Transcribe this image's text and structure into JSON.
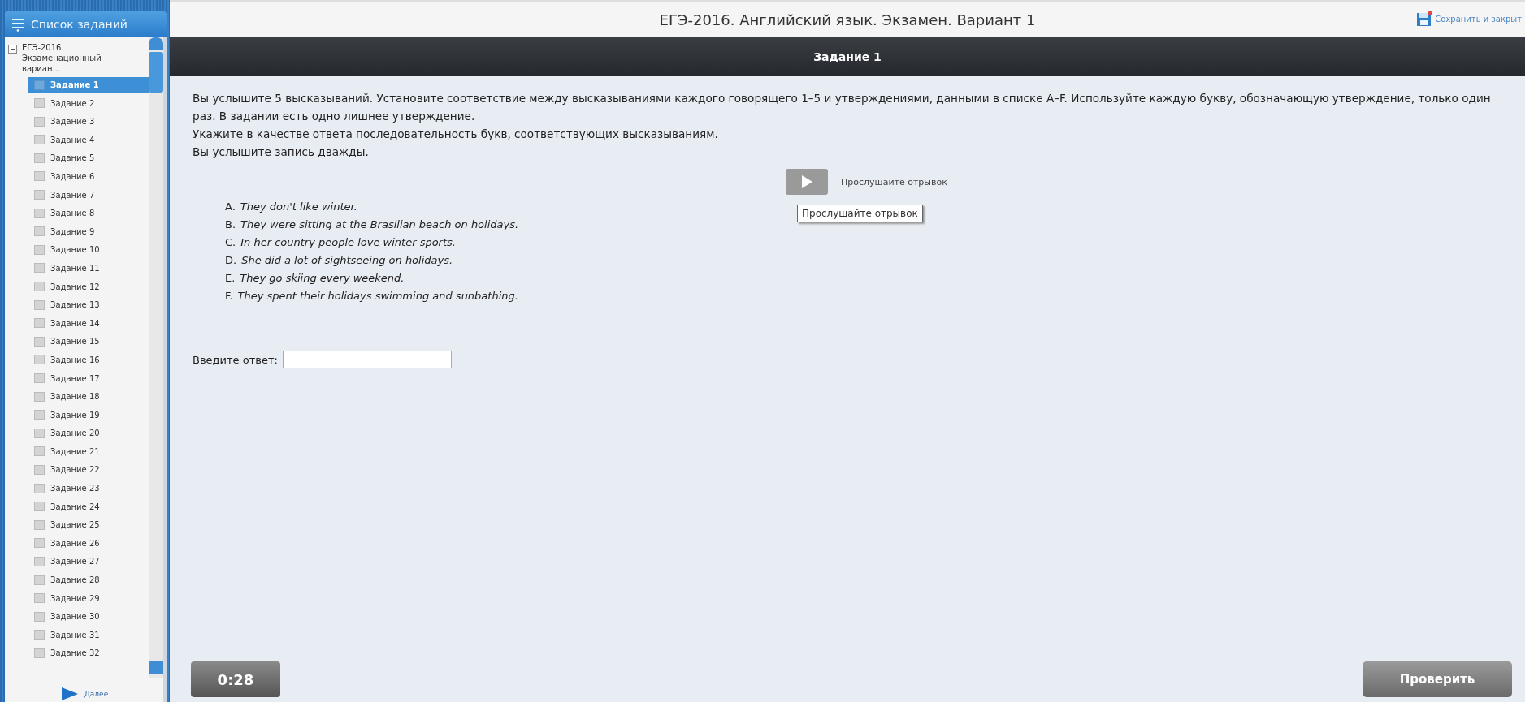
{
  "header": {
    "title": "ЕГЭ-2016. Английский язык. Экзамен. Вариант 1",
    "save_label": "Сохранить и закрыт"
  },
  "sidebar": {
    "title": "Список заданий",
    "tree": [
      {
        "label": "ЕГЭ-2016. Экзаменационный вариан...",
        "expanded": true,
        "children": [
          {
            "label": "Задание 1",
            "selected": true
          },
          {
            "label": "Задание 2",
            "selected": false
          },
          {
            "label": "Задание 3",
            "selected": false
          },
          {
            "label": "Задание 4",
            "selected": false
          },
          {
            "label": "Задание 5",
            "selected": false
          },
          {
            "label": "Задание 6",
            "selected": false
          },
          {
            "label": "Задание 7",
            "selected": false
          },
          {
            "label": "Задание 8",
            "selected": false
          },
          {
            "label": "Задание 9",
            "selected": false
          },
          {
            "label": "Задание 10",
            "selected": false
          },
          {
            "label": "Задание 11",
            "selected": false
          },
          {
            "label": "Задание 12",
            "selected": false
          },
          {
            "label": "Задание 13",
            "selected": false
          },
          {
            "label": "Задание 14",
            "selected": false
          },
          {
            "label": "Задание 15",
            "selected": false
          },
          {
            "label": "Задание 16",
            "selected": false
          },
          {
            "label": "Задание 17",
            "selected": false
          },
          {
            "label": "Задание 18",
            "selected": false
          },
          {
            "label": "Задание 19",
            "selected": false
          },
          {
            "label": "Задание 20",
            "selected": false
          },
          {
            "label": "Задание 21",
            "selected": false
          },
          {
            "label": "Задание 22",
            "selected": false
          },
          {
            "label": "Задание 23",
            "selected": false
          },
          {
            "label": "Задание 24",
            "selected": false
          },
          {
            "label": "Задание 25",
            "selected": false
          },
          {
            "label": "Задание 26",
            "selected": false
          },
          {
            "label": "Задание 27",
            "selected": false
          },
          {
            "label": "Задание 28",
            "selected": false
          },
          {
            "label": "Задание 29",
            "selected": false
          },
          {
            "label": "Задание 30",
            "selected": false
          },
          {
            "label": "Задание 31",
            "selected": false
          },
          {
            "label": "Задание 32",
            "selected": false
          }
        ]
      }
    ],
    "next_label": "Далее"
  },
  "task": {
    "title": "Задание 1",
    "instructions": [
      "Вы услышите 5 высказываний. Установите соответствие между высказываниями каждого говорящего 1–5 и утверждениями, данными в списке A–F. Используйте каждую букву, обозначающую утверждение, только один раз. В задании есть одно лишнее утверждение.",
      "Укажите в качестве ответа последовательность букв, соответствующих высказываниям.",
      "Вы услышите запись дважды."
    ],
    "play_label": "Прослушайте отрывок",
    "tooltip": "Прослушайте отрывок",
    "options": [
      {
        "letter": "A.",
        "text": "They don't like winter."
      },
      {
        "letter": "B.",
        "text": "They were sitting at the Brasilian beach on holidays."
      },
      {
        "letter": "C.",
        "text": "In her country people love winter sports."
      },
      {
        "letter": "D.",
        "text": "She did a lot of sightseeing on holidays."
      },
      {
        "letter": "E.",
        "text": "They go skiing every weekend."
      },
      {
        "letter": "F.",
        "text": "They spent their holidays swimming and sunbathing."
      }
    ],
    "answer_label": "Введите ответ:"
  },
  "timer": "0:28",
  "check_button": "Проверить"
}
